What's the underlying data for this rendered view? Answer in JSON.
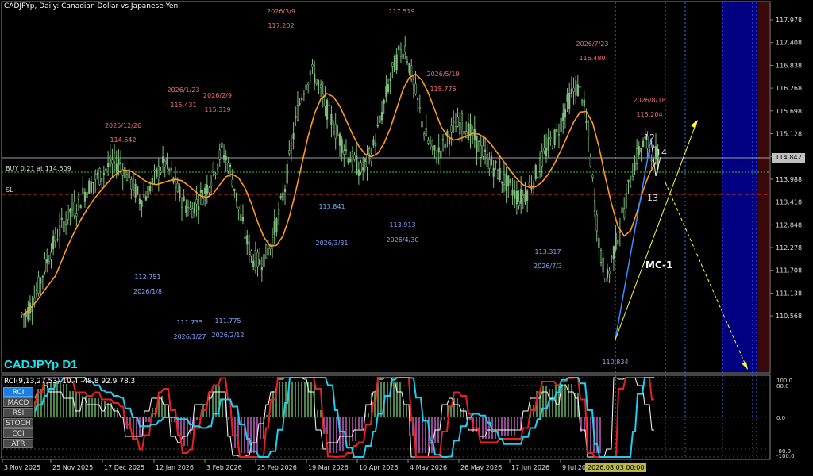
{
  "header": {
    "title": "CADJPYp, Daily:  Canadian Dollar vs Japanese Yen"
  },
  "watermark": "CADJPYp D1",
  "trade": {
    "buy_label": "BUY 0.21 at 114.509",
    "sl_label": "SL",
    "current_price": "114.842"
  },
  "price_axis": [
    "117.978",
    "117.408",
    "116.838",
    "116.268",
    "115.698",
    "115.128",
    "114.558",
    "113.988",
    "113.418",
    "112.848",
    "112.278",
    "111.708",
    "111.138",
    "110.568"
  ],
  "time_axis": [
    "3 Nov 2025",
    "25 Nov 2025",
    "17 Dec 2025",
    "12 Jan 2026",
    "3 Feb 2026",
    "25 Feb 2026",
    "19 Mar 2026",
    "10 Apr 2026",
    "4 May 2026",
    "26 May 2026",
    "17 Jun 2026",
    "9 Jul 2026"
  ],
  "cursor_date": "2026.08.03 00:00",
  "high_labels": [
    {
      "date": "2025/12/26",
      "price": "114.642"
    },
    {
      "date": "2026/1/23",
      "price": "115.431"
    },
    {
      "date": "2026/2/9",
      "price": "115.319"
    },
    {
      "date": "2026/3/9",
      "price": "117.202"
    },
    {
      "date": "",
      "price": "117.519"
    },
    {
      "date": "2026/5/19",
      "price": "115.776"
    },
    {
      "date": "2026/7/23",
      "price": "116.480"
    },
    {
      "date": "2026/8/18",
      "price": "115.204"
    }
  ],
  "low_labels": [
    {
      "date": "2026/1/8",
      "price": "112.751"
    },
    {
      "date": "2026/1/27",
      "price": "111.735"
    },
    {
      "date": "2026/2/12",
      "price": "111.775"
    },
    {
      "date": "2026/3/31",
      "price": "113.841"
    },
    {
      "date": "2026/4/30",
      "price": "113.913"
    },
    {
      "date": "2026/7/3",
      "price": "113.317"
    },
    {
      "date": "",
      "price": "110.834"
    }
  ],
  "wave_labels": [
    "12",
    "13",
    "14",
    "MC-1"
  ],
  "indicator": {
    "header": "RCI(9,13,27,53) 10.4 -48.8 92.9 78.3",
    "buttons": [
      "RCI",
      "MACD",
      "RSI",
      "STOCH",
      "CCI",
      "ATR"
    ],
    "axis": [
      "100.0",
      "80.0",
      "0.0",
      "-80.0",
      "-100.0"
    ]
  },
  "colors": {
    "background": "#000000",
    "candle": "#7fbf7f",
    "ma": "#ff9a1e",
    "high_label": "#f07070",
    "low_label": "#7fa8ff",
    "buy_line": "#2ecc40",
    "sl_line": "#e03030",
    "watermark": "#19e6f0",
    "forecast_zone": "#000080",
    "rci_fast": "#ffffff",
    "rci_mid": "#e82020",
    "rci_slow": "#22ccee"
  },
  "chart_data": {
    "type": "candlestick",
    "series": [
      {
        "name": "",
        "values": [
          110.6,
          110.9,
          111.3,
          111.8,
          112.2,
          112.6,
          112.9,
          113.2,
          113.3,
          113.6,
          113.8,
          114.0,
          114.1,
          114.3,
          114.4,
          114.4,
          114.1,
          113.8,
          113.5,
          113.6,
          113.9,
          114.2,
          114.4,
          114.1,
          113.7,
          113.4,
          113.2,
          113.4,
          113.6,
          113.9,
          114.3,
          114.7,
          114.4,
          113.8,
          113.0,
          112.4,
          112.0,
          111.9,
          112.1,
          112.5,
          113.1,
          113.8,
          114.8,
          115.7,
          116.3,
          116.7,
          116.5,
          116.0,
          115.6,
          115.2,
          114.9,
          114.6,
          114.4,
          114.2,
          114.4,
          114.8,
          115.4,
          116.1,
          116.7,
          117.1,
          117.3,
          116.6,
          115.9,
          115.2,
          114.8,
          114.6,
          114.8,
          115.1,
          115.3,
          115.4,
          115.2,
          115.0,
          114.7,
          114.5,
          114.3,
          114.1,
          113.9,
          113.7,
          113.5,
          113.6,
          113.9,
          114.2,
          114.6,
          114.9,
          115.1,
          115.6,
          116.0,
          116.3,
          116.1,
          115.0,
          113.4,
          112.0,
          111.5,
          112.2,
          112.8,
          113.5,
          114.2,
          114.7,
          114.9,
          114.7,
          114.5
        ]
      }
    ],
    "overlays": [
      "Moving average (orange)",
      "Buy entry level",
      "Stop-loss level",
      "Elliott wave lines 12-13-14",
      "Projection arrows"
    ]
  }
}
